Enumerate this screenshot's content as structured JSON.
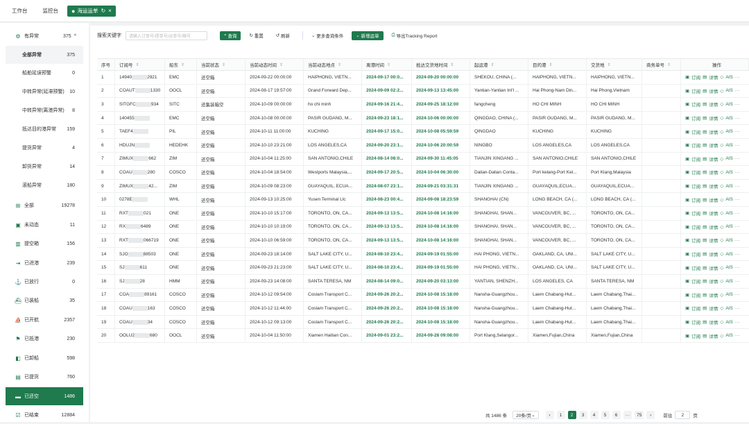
{
  "tabs": [
    {
      "label": "工作台",
      "active": false
    },
    {
      "label": "监控台",
      "active": false
    },
    {
      "label": "海运运单",
      "active": true
    }
  ],
  "sidebar": {
    "items": [
      {
        "icon": "gear-icon",
        "glyph": "⚙",
        "label": "有异常",
        "count": "375",
        "chevron": "^",
        "type": "group"
      },
      {
        "label": "全部异常",
        "count": "375",
        "type": "sub-selected"
      },
      {
        "label": "船舶延误预警",
        "count": "0",
        "type": "sub"
      },
      {
        "label": "中转异常(延滞预警)",
        "count": "10",
        "type": "sub"
      },
      {
        "label": "中转异常(离港异常)",
        "count": "8",
        "type": "sub"
      },
      {
        "label": "抵达目的港异常",
        "count": "159",
        "type": "sub"
      },
      {
        "label": "提货异常",
        "count": "4",
        "type": "sub"
      },
      {
        "label": "卸货异常",
        "count": "14",
        "type": "sub"
      },
      {
        "label": "滚船异常",
        "count": "180",
        "type": "sub"
      },
      {
        "icon": "grid-icon",
        "glyph": "⊞",
        "label": "全部",
        "count": "19278",
        "type": "group"
      },
      {
        "icon": "box-icon",
        "glyph": "▣",
        "label": "未动态",
        "count": "11",
        "type": "group"
      },
      {
        "icon": "building-icon",
        "glyph": "▥",
        "label": "提空箱",
        "count": "156",
        "type": "group"
      },
      {
        "icon": "enter-icon",
        "glyph": "⇥",
        "label": "已进港",
        "count": "239",
        "type": "group"
      },
      {
        "icon": "port-icon",
        "glyph": "⚓",
        "label": "已放行",
        "count": "0",
        "type": "group"
      },
      {
        "icon": "ship-icon",
        "glyph": "⛴",
        "label": "已装船",
        "count": "35",
        "type": "group"
      },
      {
        "icon": "sail-icon",
        "glyph": "⛵",
        "label": "已开航",
        "count": "2357",
        "type": "group"
      },
      {
        "icon": "harbor-icon",
        "glyph": "⚑",
        "label": "已抵港",
        "count": "230",
        "type": "group"
      },
      {
        "icon": "unload-icon",
        "glyph": "◧",
        "label": "已卸船",
        "count": "598",
        "type": "group"
      },
      {
        "icon": "pickup-icon",
        "glyph": "▤",
        "label": "已提货",
        "count": "760",
        "type": "group"
      },
      {
        "icon": "return-icon",
        "glyph": "▬",
        "label": "已还空",
        "count": "1486",
        "type": "active"
      },
      {
        "icon": "done-icon",
        "glyph": "☑",
        "label": "已结束",
        "count": "12884",
        "type": "group"
      }
    ]
  },
  "filter": {
    "label": "搜索关键字",
    "placeholder": "请输入订单号/提单号/运单号/箱号",
    "query": "查询",
    "reset": "重置",
    "refresh": "刷新",
    "more": "更多查询条件",
    "new": "新增运单",
    "export": "导出Tracking Report"
  },
  "table": {
    "headers": [
      "序号",
      "订阅号",
      "船东",
      "当前状态",
      "当前动态时间",
      "当前动态地点",
      "离港时间",
      "抵达交货地时间",
      "起运港",
      "目的港",
      "交货地",
      "商务单号",
      "操作"
    ],
    "op_labels": {
      "track": "订阅",
      "detail": "详情",
      "ais": "AIS",
      "more": "···"
    },
    "rows": [
      [
        "1",
        "14940",
        "2921",
        "EMC",
        "还空箱",
        "2024-09-22 00:00:00",
        "HAIPHONG, VIETN...",
        "2024-09-17 00:0...",
        "2024-09-20 00:00:00",
        "SHEKOU, CHINA (...",
        "HAIPHONG, VIETN...",
        "HAIPHONG, VIETN..."
      ],
      [
        "2",
        "COAUT",
        "1330",
        "OOCL",
        "还空箱",
        "2024-08-17 19:57:00",
        "Grand Forward Dep...",
        "2024-09-09 02:2...",
        "2024-09-13 13:45:00",
        "Yantian-Yantian Int'l ...",
        "Hai Phong-Nam Din...",
        "Hai Phong,Vietnam"
      ],
      [
        "3",
        "SITGFC",
        "934",
        "SITC",
        "还集装箱空",
        "2024-10-09 00:00:00",
        "ho chi minh",
        "2024-09-16 21:4...",
        "2024-09-25 18:12:00",
        "fangcheng",
        "HO CHI MINH",
        "HO CHI MINH"
      ],
      [
        "4",
        "140455",
        "",
        "EMC",
        "还空箱",
        "2024-10-08 00:00:00",
        "PASIR GUDANG, M...",
        "2024-09-23 18:1...",
        "2024-10-06 00:00:00",
        "QINGDAO, CHINA (...",
        "PASIR GUDANG, M...",
        "PASIR GUDANG, M..."
      ],
      [
        "5",
        "TAEF4",
        "",
        "PIL",
        "还空箱",
        "2024-10-11 11:00:00",
        "KUCHING",
        "2024-09-17 15:0...",
        "2024-10-08 05:59:59",
        "QINGDAO",
        "KUCHING",
        "KUCHING"
      ],
      [
        "6",
        "HDUJN",
        "",
        "HEDEHK",
        "还空箱",
        "2024-10-10 23:21:00",
        "LOS ANGELES,CA",
        "2024-09-20 23:1...",
        "2024-10-06 20:00:59",
        "NINGBO",
        "LOS ANGELES,CA",
        "LOS ANGELES,CA"
      ],
      [
        "7",
        "ZIMUX",
        "662",
        "ZIM",
        "还空箱",
        "2024-10-04 11:25:00",
        "SAN ANTONIO,CHILE",
        "2024-08-14 08:0...",
        "2024-09-30 11:45:05",
        "TIANJIN XINGANG ...",
        "SAN ANTONIO,CHILE",
        "SAN ANTONIO,CHILE"
      ],
      [
        "8",
        "COAU",
        "280",
        "COSCO",
        "还空箱",
        "2024-10-04 18:54:00",
        "Westports Malaysia,...",
        "2024-09-17 20:5...",
        "2024-10-04 06:30:00",
        "Dalian-Dalian Conta...",
        "Port kelang-Port Kel...",
        "Port Klang,Malaysia"
      ],
      [
        "9",
        "ZIMUX",
        "42...",
        "ZIM",
        "还空箱",
        "2024-10-09 08:23:00",
        "GUAYAQUIL, ECUA...",
        "2024-08-07 23:1...",
        "2024-09-21 03:31:31",
        "TIANJIN XINGANG ...",
        "GUAYAQUIL,ECUA...",
        "GUAYAQUIL,ECUA..."
      ],
      [
        "10",
        "0278E",
        "",
        "WHL",
        "还空箱",
        "2024-09-13 10:25:00",
        "Yusen Terminal Llc",
        "2024-08-23 00:4...",
        "2024-09-08 18:23:59",
        "SHANGHAI (CN)",
        "LONG BEACH, CA (...",
        "LONG BEACH, CA (..."
      ],
      [
        "11",
        "RXT",
        "021",
        "ONE",
        "还空箱",
        "2024-10-10 15:17:00",
        "TORONTO, ON, CA...",
        "2024-09-13 13:5...",
        "2024-10-08 14:16:00",
        "SHANGHAI, SHAN...",
        "VANCOUVER, BC, ...",
        "TORONTO, ON, CA..."
      ],
      [
        "12",
        "RX",
        "6489",
        "ONE",
        "还空箱",
        "2024-10-10 10:19:00",
        "TORONTO, ON, CA...",
        "2024-09-13 13:5...",
        "2024-10-08 14:16:00",
        "SHANGHAI, SHAN...",
        "VANCOUVER, BC, ...",
        "TORONTO, ON, CA..."
      ],
      [
        "13",
        "RXT",
        "066719",
        "ONE",
        "还空箱",
        "2024-10-10 06:59:00",
        "TORONTO, ON, CA...",
        "2024-09-13 13:5...",
        "2024-10-08 14:16:00",
        "SHANGHAI, SHAN...",
        "VANCOUVER, BC, ...",
        "TORONTO, ON, CA..."
      ],
      [
        "14",
        "SJO",
        "88503",
        "ONE",
        "还空箱",
        "2024-09-23 18:14:00",
        "SALT LAKE CITY, U...",
        "2024-08-10 23:4...",
        "2024-09-19 01:55:00",
        "HAI PHONG, VIETN...",
        "OAKLAND, CA, UNI...",
        "SALT LAKE CITY, U..."
      ],
      [
        "15",
        "SJ",
        "611",
        "ONE",
        "还空箱",
        "2024-09-23 21:23:00",
        "SALT LAKE CITY, U...",
        "2024-08-10 23:4...",
        "2024-09-19 01:55:00",
        "HAI PHONG, VIETN...",
        "OAKLAND, CA, UNI...",
        "SALT LAKE CITY, U..."
      ],
      [
        "16",
        "SJ",
        "28",
        "HMM",
        "还空箱",
        "2024-09-23 14:08:00",
        "SANTA TERESA, NM",
        "2024-08-14 09:0...",
        "2024-09-20 03:13:00",
        "YANTIAN, SHENZH...",
        "LOS ANGELES, CA",
        "SANTA TERESA, NM"
      ],
      [
        "17",
        "COA",
        "89161",
        "COSCO",
        "还空箱",
        "2024-10-12 09:54:00",
        "Coslam Transport C...",
        "2024-09-26 20:2...",
        "2024-10-08 15:18:00",
        "Nansha-Guangzhou...",
        "Laem Chabang-Hut...",
        "Laem Chabang,Thai..."
      ],
      [
        "18",
        "COAU",
        "163",
        "COSCO",
        "还空箱",
        "2024-10-12 11:44:00",
        "Coslam Transport C...",
        "2024-09-26 20:2...",
        "2024-10-08 15:18:00",
        "Nansha-Guangzhou...",
        "Laem Chabang-Hut...",
        "Laem Chabang,Thai..."
      ],
      [
        "19",
        "COAU",
        "34",
        "COSCO",
        "还空箱",
        "2024-10-12 09:13:00",
        "Coslam Transport C...",
        "2024-09-26 20:2...",
        "2024-10-08 15:18:00",
        "Nansha-Guangzhou...",
        "Laem Chabang-Hut...",
        "Laem Chabang,Thai..."
      ],
      [
        "20",
        "OOLU2",
        "680",
        "OOCL",
        "还空箱",
        "2024-10-04 11:50:00",
        "Xiamen Haitian Con...",
        "2024-09-01 23:2...",
        "2024-09-28 09:08:00",
        "Port Klang,Selangor...",
        "Xiamen,Fujian,China",
        "Xiamen,Fujian,China"
      ]
    ]
  },
  "pager": {
    "total": "共 1486 条",
    "size": "20条/页",
    "pages": [
      "1",
      "2",
      "3",
      "4",
      "5",
      "6",
      "···",
      "75"
    ],
    "current": "2",
    "goto_label": "前往",
    "goto_value": "2",
    "page_suffix": "页"
  },
  "colors": {
    "brand": "#1f7a4d"
  }
}
